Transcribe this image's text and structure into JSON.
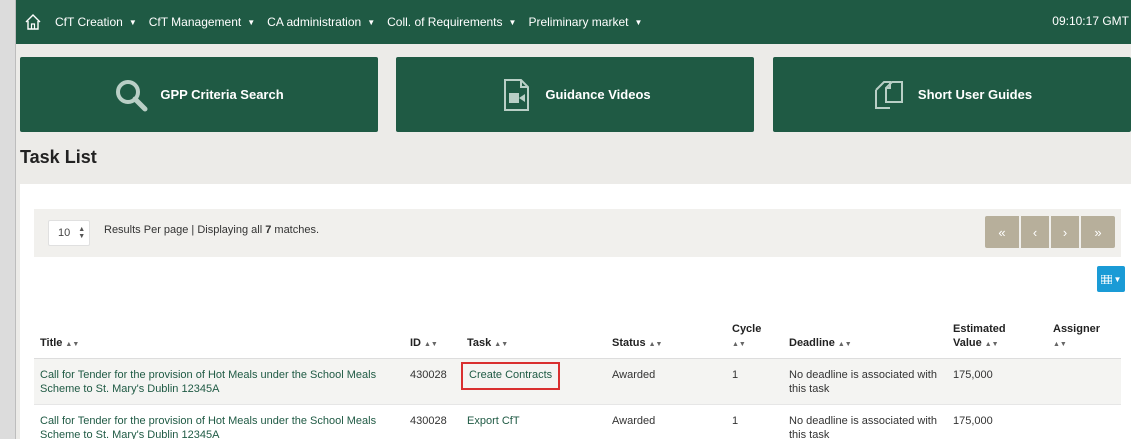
{
  "topbar": {
    "nav": [
      {
        "label": "CfT Creation"
      },
      {
        "label": "CfT Management"
      },
      {
        "label": "CA administration"
      },
      {
        "label": "Coll. of Requirements"
      },
      {
        "label": "Preliminary market"
      }
    ],
    "clock": "09:10:17 GMT",
    "icons": {
      "home": "home-icon",
      "dropdown": "caret-down-icon"
    }
  },
  "tiles": [
    {
      "label": "GPP Criteria Search",
      "icon": "search-icon"
    },
    {
      "label": "Guidance Videos",
      "icon": "video-file-icon"
    },
    {
      "label": "Short User Guides",
      "icon": "documents-icon"
    }
  ],
  "page": {
    "title": "Task List"
  },
  "list_controls": {
    "per_page_value": "10",
    "results_prefix": "Results Per page | Displaying all ",
    "results_count": "7",
    "results_suffix": " matches.",
    "pager": {
      "first": "«",
      "prev": "‹",
      "next": "›",
      "last": "»"
    }
  },
  "table": {
    "columns": {
      "title": "Title",
      "id": "ID",
      "task": "Task",
      "status": "Status",
      "cycle": "Cycle",
      "deadline": "Deadline",
      "estimated_value_line1": "Estimated",
      "estimated_value_line2": "Value",
      "assigner": "Assigner"
    },
    "rows": [
      {
        "title": "Call for Tender for the provision of Hot Meals under the School Meals Scheme to St. Mary's Dublin 12345A",
        "id": "430028",
        "task": "Create Contracts",
        "status": "Awarded",
        "cycle": "1",
        "deadline": "No deadline is associated with this task",
        "estimated_value": "175,000",
        "assigner": ""
      },
      {
        "title": "Call for Tender for the provision of Hot Meals under the School Meals Scheme to St. Mary's Dublin 12345A",
        "id": "430028",
        "task": "Export CfT",
        "status": "Awarded",
        "cycle": "1",
        "deadline": "No deadline is associated with this task",
        "estimated_value": "175,000",
        "assigner": ""
      }
    ]
  },
  "colors": {
    "brand": "#1f5a44",
    "pager": "#b7af9b",
    "accent": "#1a9bd6",
    "highlight": "#d92f2f"
  }
}
